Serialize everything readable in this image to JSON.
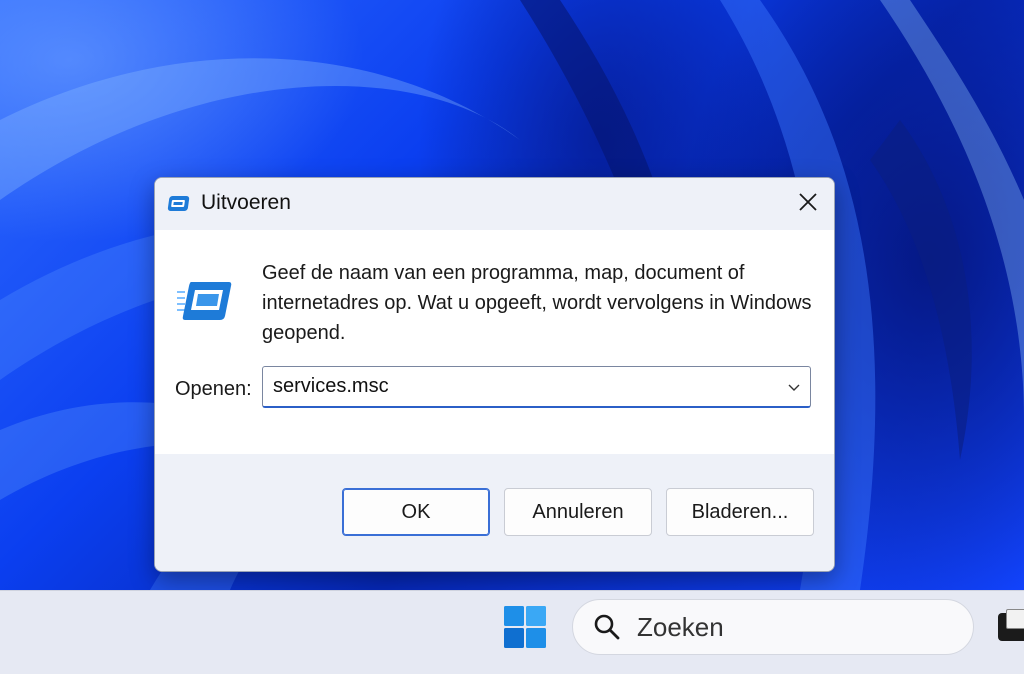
{
  "dialog": {
    "title": "Uitvoeren",
    "description": "Geef de naam van een programma, map, document of internetadres op. Wat u opgeeft, wordt vervolgens in Windows geopend.",
    "open_label": "Openen:",
    "open_value": "services.msc",
    "buttons": {
      "ok": "OK",
      "cancel": "Annuleren",
      "browse": "Bladeren..."
    },
    "icons": {
      "title": "run-app-icon",
      "close": "close-icon",
      "big": "run-app-icon",
      "dropdown": "chevron-down-icon"
    }
  },
  "taskbar": {
    "search_label": "Zoeken",
    "icons": {
      "start": "windows-logo-icon",
      "search": "search-icon",
      "app": "app-window-icon"
    }
  },
  "colors": {
    "wallpaper": "#0a2fd6",
    "accent": "#3a6fd6",
    "run_icon": "#1e7bd8"
  }
}
